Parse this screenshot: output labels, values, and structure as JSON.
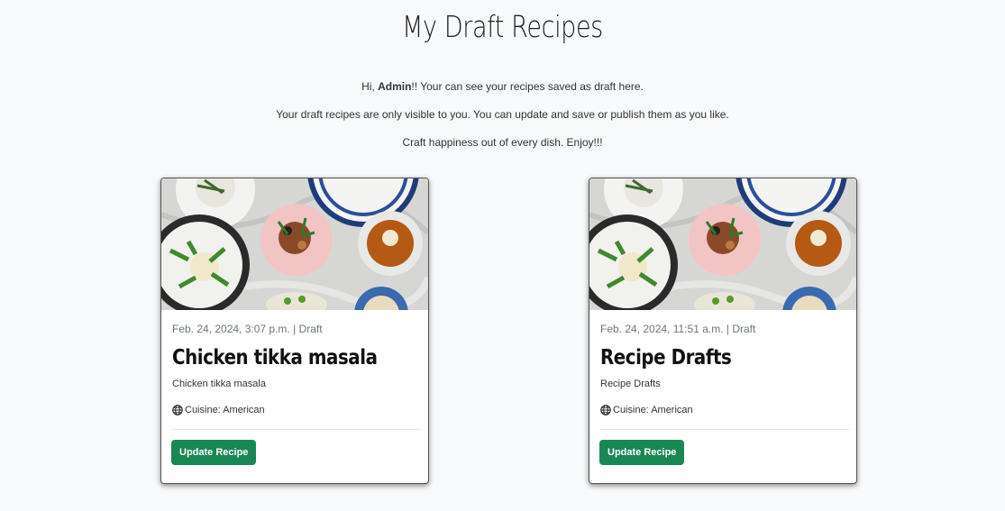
{
  "page": {
    "title": "My Draft Recipes",
    "intro_greeting_prefix": "Hi, ",
    "intro_username": "Admin",
    "intro_greeting_suffix": "!! Your can see your recipes saved as draft here.",
    "intro_line2": "Your draft recipes are only visible to you. You can update and save or publish them as you like.",
    "intro_line3": "Craft happiness out of every dish. Enjoy!!!"
  },
  "recipes": [
    {
      "meta": "Feb. 24, 2024, 3:07 p.m. | Draft",
      "title": "Chicken tikka masala",
      "excerpt": "Chicken tikka masala",
      "cuisine": "Cuisine: American",
      "button_label": "Update Recipe",
      "image_icon": "food-photo"
    },
    {
      "meta": "Feb. 24, 2024, 11:51 a.m. | Draft",
      "title": "Recipe Drafts",
      "excerpt": "Recipe Drafts",
      "cuisine": "Cuisine: American",
      "button_label": "Update Recipe",
      "image_icon": "food-photo"
    }
  ],
  "colors": {
    "accent": "#198754",
    "background": "#f8f9fa",
    "muted_text": "#6c757d"
  },
  "icons": {
    "cuisine": "globe-icon"
  }
}
